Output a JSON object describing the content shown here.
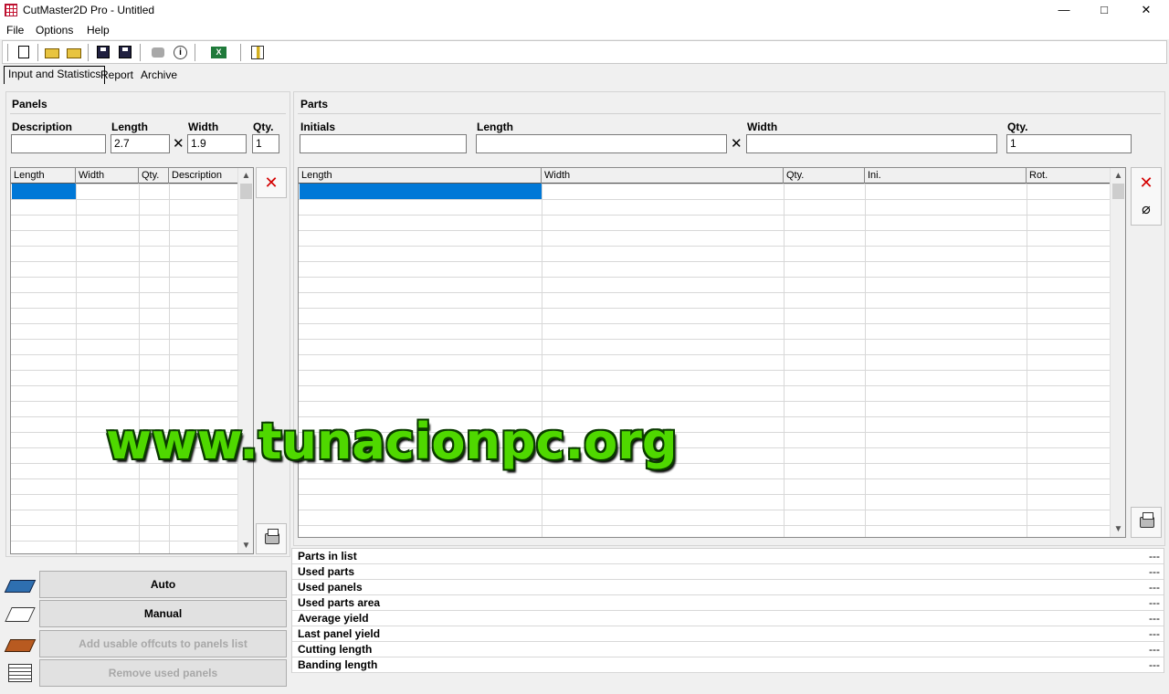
{
  "window": {
    "title": "CutMaster2D Pro - Untitled",
    "minimize": "—",
    "maximize": "□",
    "close": "✕"
  },
  "menu": [
    "File",
    "Options",
    "Help"
  ],
  "tabs": [
    "Input and Statistics",
    "Report",
    "Archive"
  ],
  "panels": {
    "title": "Panels",
    "labels": {
      "description": "Description",
      "length": "Length",
      "width": "Width",
      "qty": "Qty."
    },
    "values": {
      "description": "",
      "length": "2.7",
      "width": "1.9",
      "qty": "1"
    },
    "times": "✕",
    "columns": [
      "Length",
      "Width",
      "Qty.",
      "Description"
    ]
  },
  "parts": {
    "title": "Parts",
    "labels": {
      "initials": "Initials",
      "length": "Length",
      "width": "Width",
      "qty": "Qty."
    },
    "values": {
      "initials": "",
      "length": "",
      "width": "",
      "qty": "1"
    },
    "times": "✕",
    "columns": [
      "Length",
      "Width",
      "Qty.",
      "Ini.",
      "Rot."
    ]
  },
  "icons": {
    "delete": "✕",
    "unlink": "⌀",
    "scroll_up": "▲",
    "scroll_down": "▼"
  },
  "buttons": {
    "auto": "Auto",
    "manual": "Manual",
    "add_offcuts": "Add usable offcuts to panels list",
    "remove_used": "Remove used panels"
  },
  "stats": [
    {
      "label": "Parts in list",
      "value": "---"
    },
    {
      "label": "Used parts",
      "value": "---"
    },
    {
      "label": "Used panels",
      "value": "---"
    },
    {
      "label": "Used parts area",
      "value": "---"
    },
    {
      "label": "Average yield",
      "value": "---"
    },
    {
      "label": "Last panel yield",
      "value": "---"
    },
    {
      "label": "Cutting length",
      "value": "---"
    },
    {
      "label": "Banding length",
      "value": "---"
    }
  ],
  "watermark": "www.tunacionpc.org",
  "toolbar_excel_label": "X"
}
